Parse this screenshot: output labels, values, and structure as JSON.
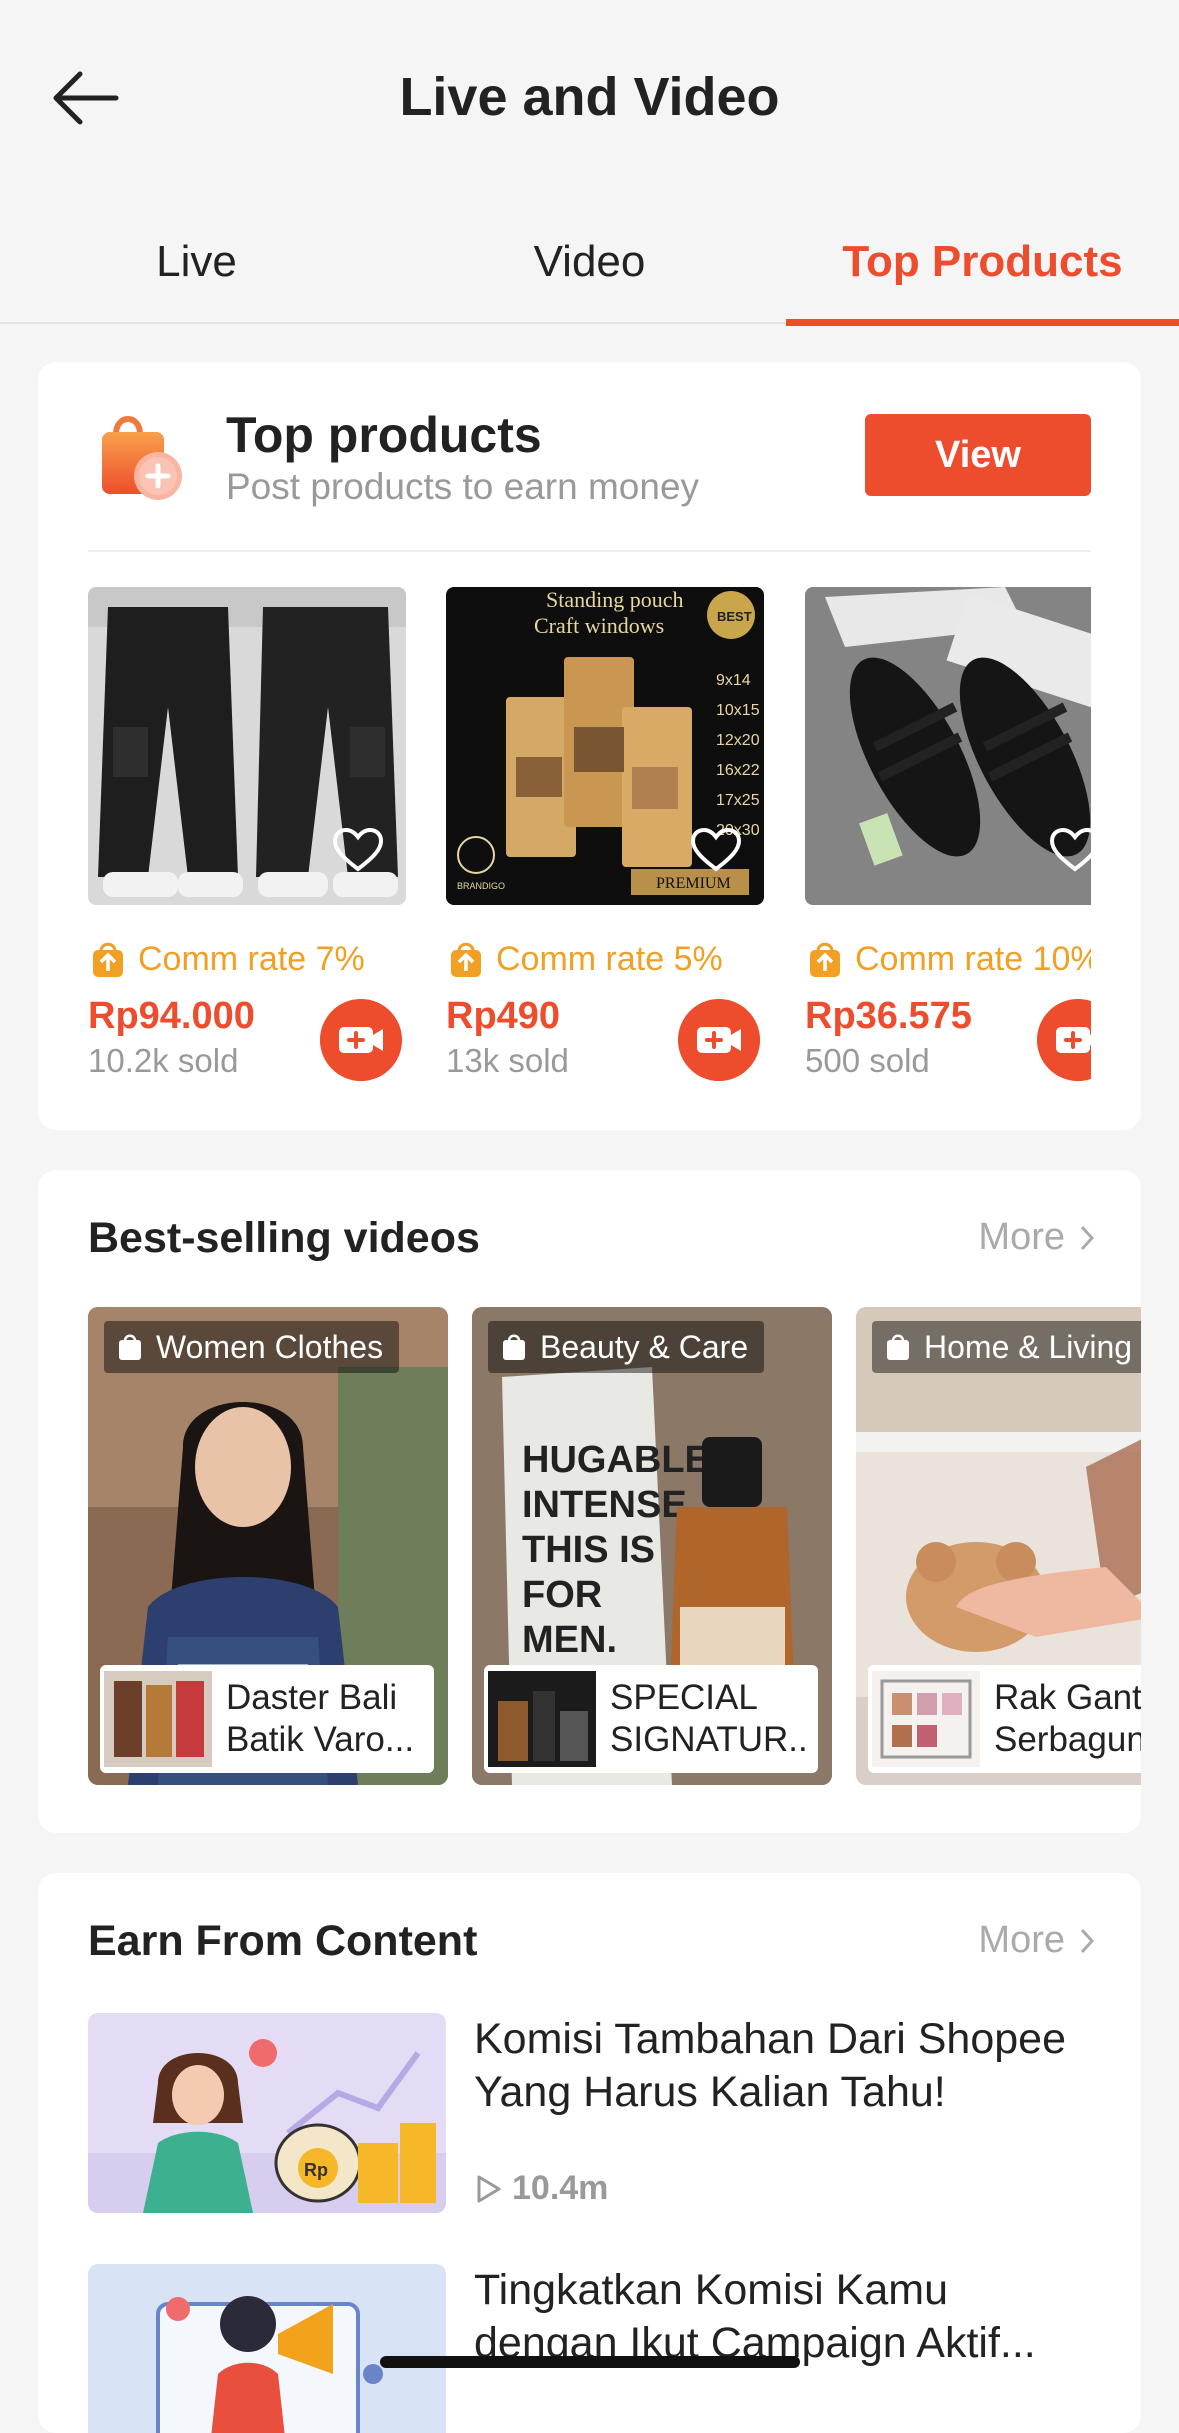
{
  "header": {
    "title": "Live and Video",
    "back_icon": "arrow-left-icon"
  },
  "tabs": [
    {
      "label": "Live",
      "active": false
    },
    {
      "label": "Video",
      "active": false
    },
    {
      "label": "Top Products",
      "active": true
    }
  ],
  "top_products": {
    "title": "Top products",
    "subtitle": "Post products to earn money",
    "view_label": "View",
    "items": [
      {
        "comm": "Comm rate 7%",
        "price": "Rp94.000",
        "sold": "10.2k sold"
      },
      {
        "comm": "Comm rate 5%",
        "price": "Rp490",
        "sold": "13k sold",
        "image_text": [
          "Standing pouch",
          "Craft windows",
          "9x14",
          "10x15",
          "12x20",
          "16x22",
          "17x25",
          "20x30",
          "BRANDIGO",
          "PREMIUM",
          "BEST"
        ]
      },
      {
        "comm": "Comm rate 10%",
        "price": "Rp36.575",
        "sold": "500 sold"
      }
    ]
  },
  "best_videos": {
    "title": "Best-selling videos",
    "more_label": "More",
    "items": [
      {
        "category": "Women Clothes",
        "line1": "Daster Bali",
        "line2": "Batik Varo..."
      },
      {
        "category": "Beauty & Care",
        "line1": "SPECIAL",
        "line2": "SIGNATUR...",
        "image_text": [
          "HUGABLE",
          "INTENSE",
          "THIS IS",
          "FOR",
          "MEN."
        ]
      },
      {
        "category": "Home & Living",
        "line1": "Rak Gantu",
        "line2": "Serbagun"
      }
    ]
  },
  "earn": {
    "title": "Earn From Content",
    "more_label": "More",
    "items": [
      {
        "title": "Komisi Tambahan Dari Shopee Yang Harus Kalian Tahu!",
        "views": "10.4m",
        "image_text": [
          "Rp"
        ]
      },
      {
        "title": "Tingkatkan Komisi Kamu dengan Ikut Campaign Aktif...",
        "views": ""
      }
    ]
  },
  "colors": {
    "accent": "#ee4d2d",
    "commission": "#f2a024",
    "muted": "#999999"
  }
}
